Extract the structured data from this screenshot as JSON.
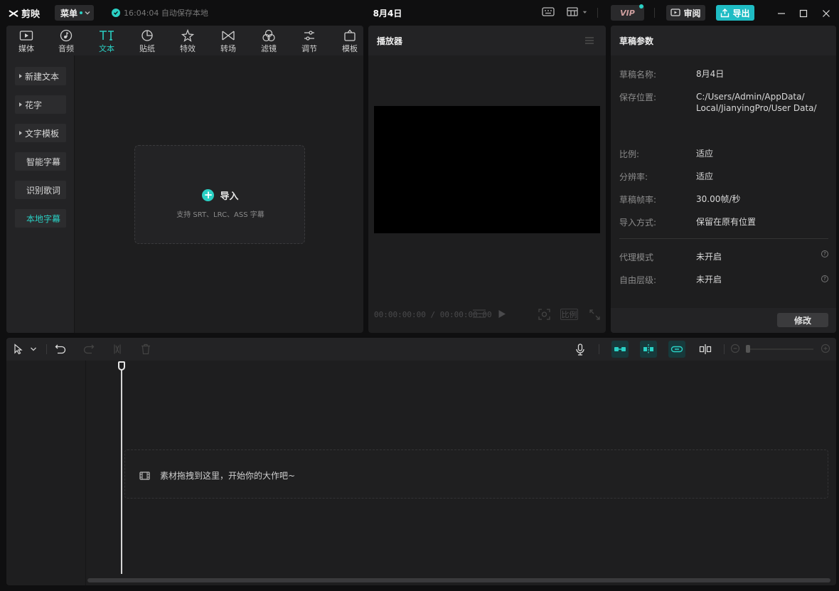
{
  "app": {
    "logo_text": "剪映",
    "menu_label": "菜单",
    "autosave_text": "16:04:04 自动保存本地",
    "project_title": "8月4日",
    "vip_label": "VIP",
    "review_label": "审阅",
    "export_label": "导出"
  },
  "toolbar": {
    "tabs": [
      {
        "label": "媒体",
        "icon": "media-icon"
      },
      {
        "label": "音频",
        "icon": "audio-icon"
      },
      {
        "label": "文本",
        "icon": "text-icon",
        "active": true
      },
      {
        "label": "贴纸",
        "icon": "sticker-icon"
      },
      {
        "label": "特效",
        "icon": "effects-icon"
      },
      {
        "label": "转场",
        "icon": "transition-icon"
      },
      {
        "label": "滤镜",
        "icon": "filter-icon"
      },
      {
        "label": "调节",
        "icon": "adjust-icon"
      },
      {
        "label": "模板",
        "icon": "template-icon"
      }
    ]
  },
  "text_sidebar": {
    "items": [
      {
        "label": "新建文本",
        "expandable": true
      },
      {
        "label": "花字",
        "expandable": true
      },
      {
        "label": "文字模板",
        "expandable": true
      },
      {
        "label": "智能字幕",
        "expandable": false
      },
      {
        "label": "识别歌词",
        "expandable": false
      },
      {
        "label": "本地字幕",
        "expandable": false,
        "active": true
      }
    ]
  },
  "import": {
    "title": "导入",
    "subtitle": "支持 SRT、LRC、ASS 字幕"
  },
  "player": {
    "title": "播放器",
    "current_time": "00:00:00:00",
    "total_time": "00:00:00:00",
    "ratio_label": "比例"
  },
  "draft": {
    "title": "草稿参数",
    "fields": [
      {
        "key": "草稿名称:",
        "value": "8月4日"
      },
      {
        "key": "保存位置:",
        "value": "C:/Users/Admin/AppData/ Local/JianyingPro/User Data/"
      },
      {
        "key": "比例:",
        "value": "适应"
      },
      {
        "key": "分辨率:",
        "value": "适应"
      },
      {
        "key": "草稿帧率:",
        "value": "30.00帧/秒"
      },
      {
        "key": "导入方式:",
        "value": "保留在原有位置"
      }
    ],
    "extra_fields": [
      {
        "key": "代理模式",
        "value": "未开启"
      },
      {
        "key": "自由层级:",
        "value": "未开启"
      }
    ],
    "modify_label": "修改"
  },
  "timeline": {
    "drop_hint": "素材拖拽到这里，开始你的大作吧~"
  },
  "colors": {
    "accent": "#2ad0c4",
    "export_button": "#1fbcc4",
    "panel_bg": "#1e1e1f",
    "app_bg": "#0f0f10"
  }
}
